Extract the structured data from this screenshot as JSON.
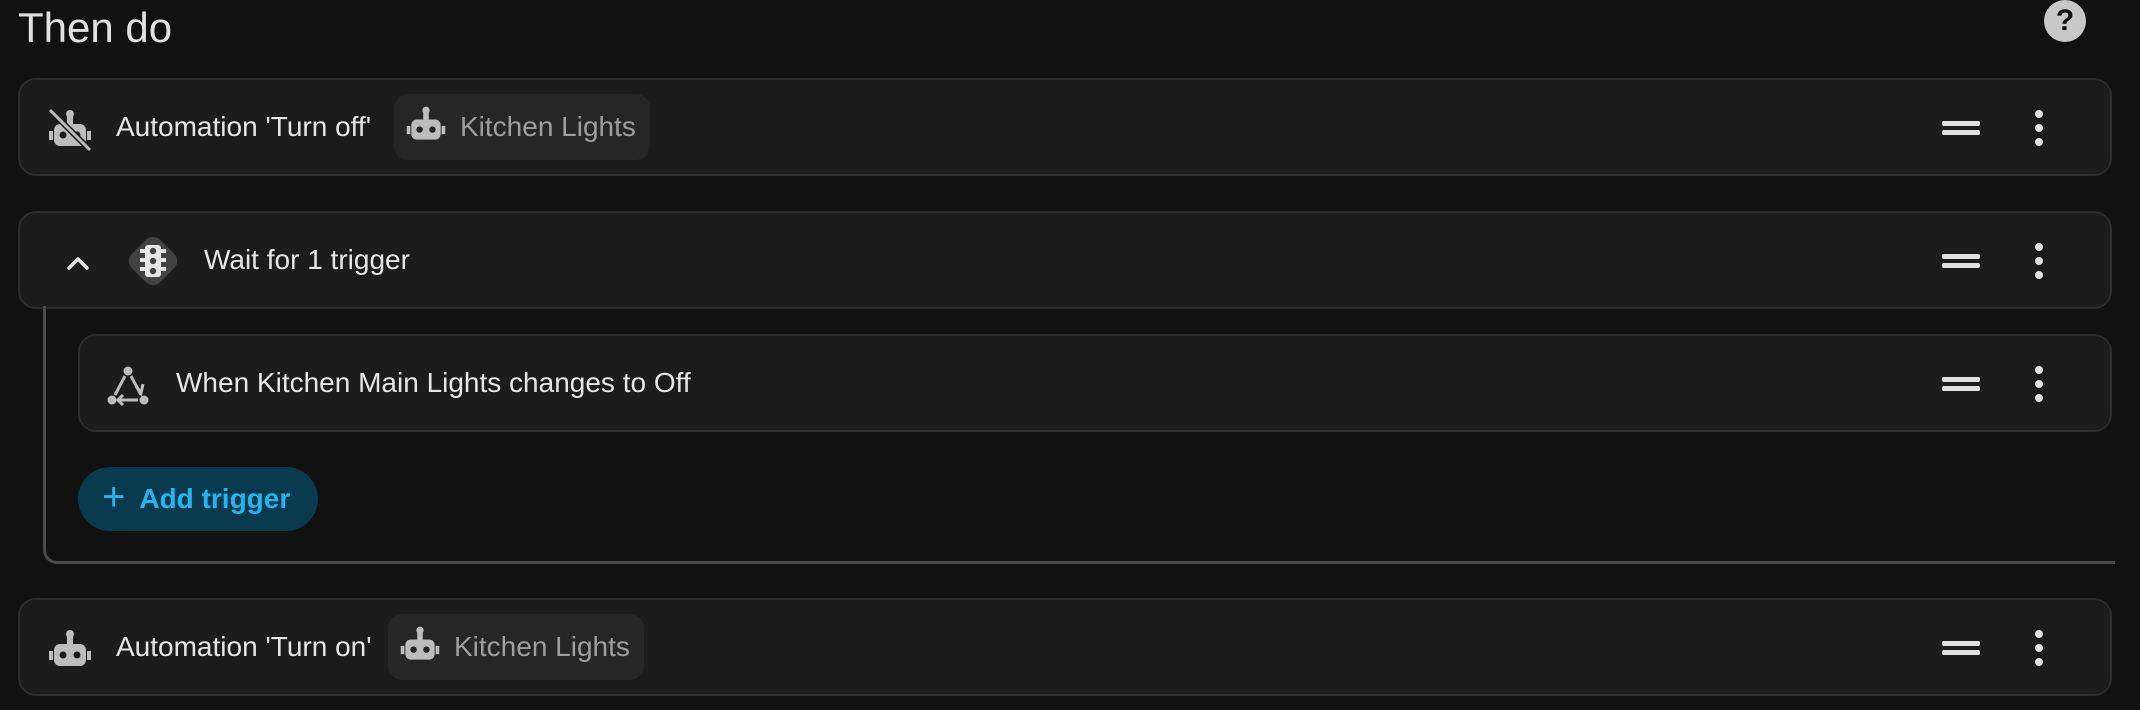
{
  "section": {
    "title": "Then do",
    "help_glyph": "?"
  },
  "actions": [
    {
      "label": "Automation 'Turn off'",
      "icon": "robot-off-icon",
      "chip_label": "Kitchen Lights",
      "chip_icon": "robot-icon"
    },
    {
      "label": "Wait for 1 trigger",
      "icon": "traffic-light-icon",
      "expand_icon": "chevron-up-icon"
    },
    {
      "label": "Automation 'Turn on'",
      "icon": "robot-icon",
      "chip_label": "Kitchen Lights",
      "chip_icon": "robot-icon"
    }
  ],
  "triggers": [
    {
      "label": "When Kitchen Main Lights changes to Off",
      "icon": "state-change-icon"
    }
  ],
  "add_trigger": {
    "label": "Add trigger",
    "icon": "plus-icon"
  },
  "colors": {
    "background": "#111111",
    "card": "#1c1c1c",
    "accent": "#26b4f0",
    "accent_bg": "#0a3a4d"
  }
}
